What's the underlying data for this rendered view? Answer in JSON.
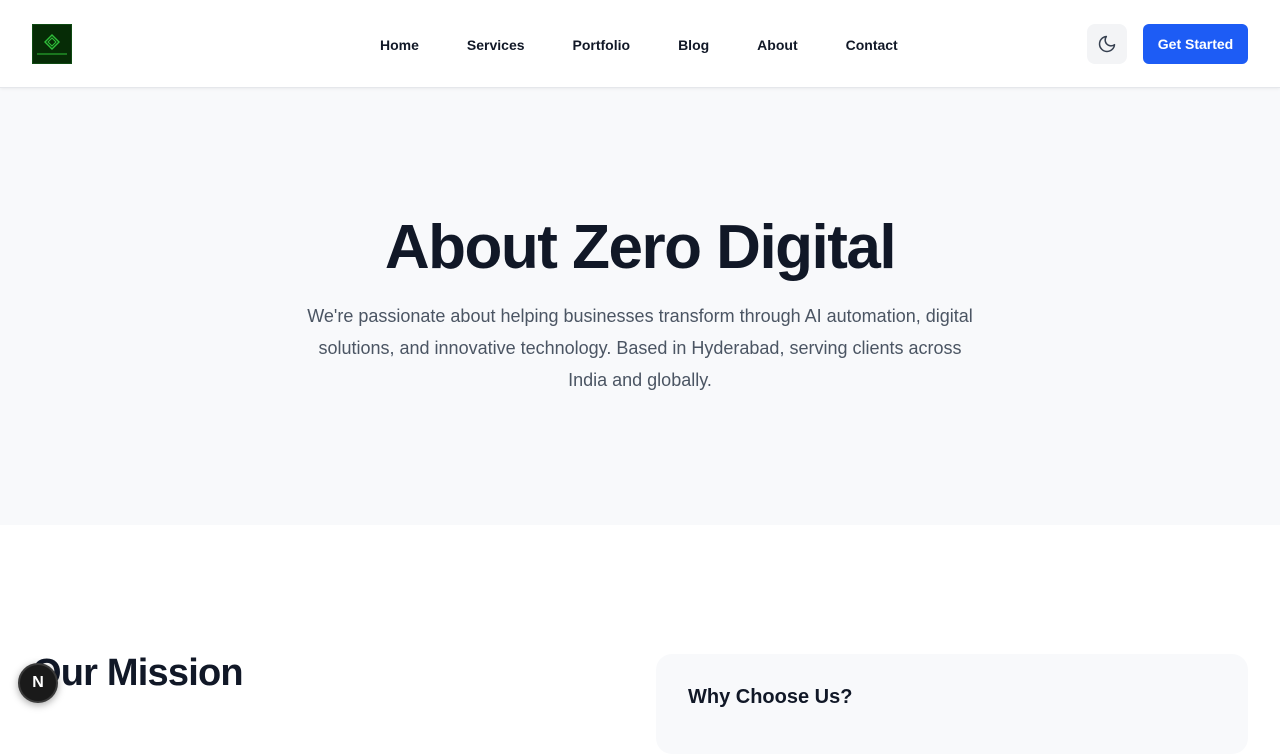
{
  "header": {
    "logo_name": "Zero Digital logo",
    "nav": [
      "Home",
      "Services",
      "Portfolio",
      "Blog",
      "About",
      "Contact"
    ],
    "theme_icon": "moon-icon",
    "cta_label": "Get Started"
  },
  "hero": {
    "title": "About Zero Digital",
    "description": "We're passionate about helping businesses transform through AI automation, digital solutions, and innovative technology. Based in Hyderabad, serving clients across India and globally."
  },
  "mission": {
    "title": "Our Mission"
  },
  "why_card": {
    "title": "Why Choose Us?"
  },
  "dev_badge": {
    "label": "N"
  },
  "colors": {
    "accent": "#1d5cf5",
    "text_dark": "#111827",
    "text_muted": "#4b5563",
    "hero_bg": "#f8f9fb",
    "logo_bg": "#062c06"
  }
}
